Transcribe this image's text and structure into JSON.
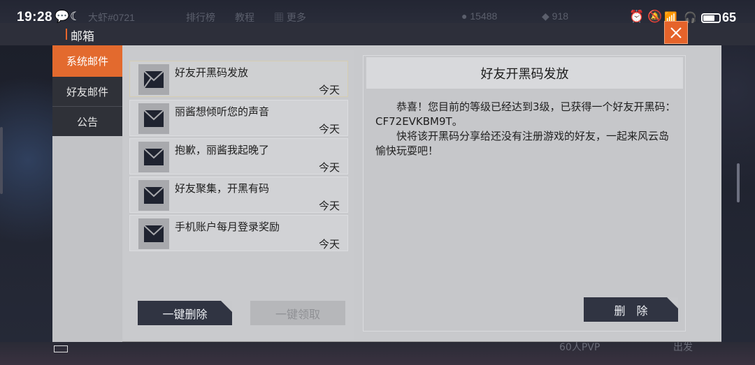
{
  "status_bar": {
    "time": "19:28",
    "battery": "65"
  },
  "game_bg": {
    "user": "大虾#0721",
    "nav_rank": "排行榜",
    "nav_tutorial": "教程",
    "nav_more": "更多",
    "gold": "15488",
    "gems": "918",
    "mode": "60人PVP",
    "start": "出发"
  },
  "header": {
    "title": "邮箱"
  },
  "tabs": [
    {
      "label": "系统邮件",
      "active": true
    },
    {
      "label": "好友邮件",
      "active": false
    },
    {
      "label": "公告",
      "active": false
    }
  ],
  "mails": [
    {
      "title": "好友开黑码发放",
      "date": "今天",
      "selected": true
    },
    {
      "title": "丽酱想倾听您的声音",
      "date": "今天",
      "selected": false
    },
    {
      "title": "抱歉，丽酱我起晚了",
      "date": "今天",
      "selected": false
    },
    {
      "title": "好友聚集，开黑有码",
      "date": "今天",
      "selected": false
    },
    {
      "title": "手机账户每月登录奖励",
      "date": "今天",
      "selected": false
    }
  ],
  "buttons": {
    "delete_all": "一键删除",
    "claim_all": "一键领取",
    "delete": "删　除"
  },
  "detail": {
    "title": "好友开黑码发放",
    "paragraphs": [
      "恭喜！您目前的等级已经达到3级，已获得一个好友开黑码：CF72EVKBM9T。",
      "快将该开黑码分享给还没有注册游戏的好友，一起来风云岛愉快玩耍吧！"
    ]
  },
  "colors": {
    "accent": "#e36a2e",
    "dark_button": "#303442",
    "panel": "#c8c9cc"
  }
}
